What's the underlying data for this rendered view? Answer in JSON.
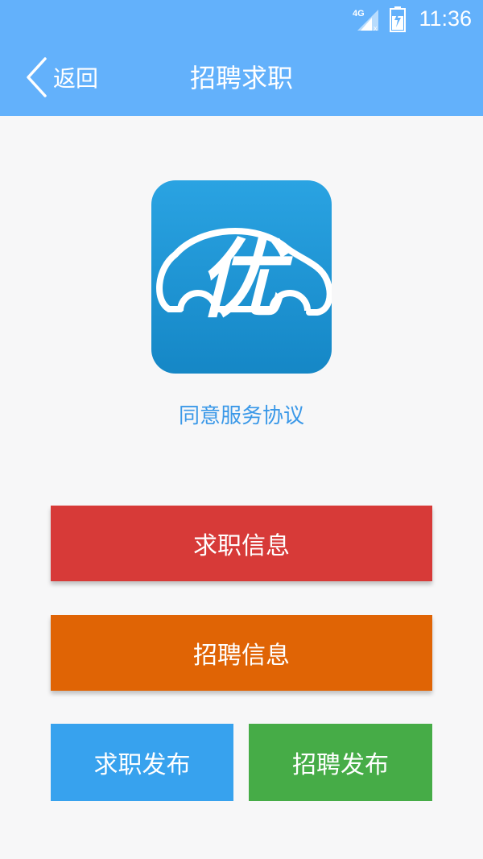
{
  "status_bar": {
    "network": "4G",
    "time": "11:36"
  },
  "header": {
    "back_label": "返回",
    "title": "招聘求职"
  },
  "logo": {
    "glyph": "优",
    "icon": "car-logo-icon"
  },
  "agreement": {
    "label": "同意服务协议"
  },
  "buttons": {
    "job_seeking_info": "求职信息",
    "recruitment_info": "招聘信息",
    "post_job_seeking": "求职发布",
    "post_recruitment": "招聘发布"
  },
  "colors": {
    "header": "#63b1fb",
    "red": "#d73a38",
    "orange": "#e06405",
    "blue": "#37a2ee",
    "green": "#46ac47",
    "link": "#3a98e8"
  }
}
